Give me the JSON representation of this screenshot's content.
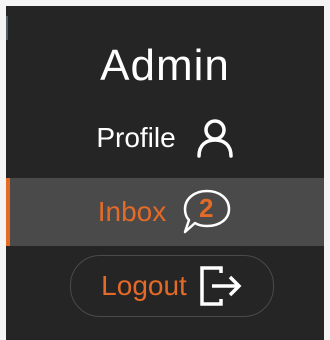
{
  "menu": {
    "title": "Admin",
    "items": [
      {
        "label": "Profile",
        "icon": "user-icon",
        "active": false
      },
      {
        "label": "Inbox",
        "icon": "chat-bubble-icon",
        "badge": "2",
        "active": true
      },
      {
        "label": "Logout",
        "icon": "logout-icon",
        "active": false
      }
    ]
  },
  "colors": {
    "panel_background": "#252525",
    "active_background": "#4a4a4a",
    "accent": "#e46a28",
    "text": "#ffffff"
  }
}
